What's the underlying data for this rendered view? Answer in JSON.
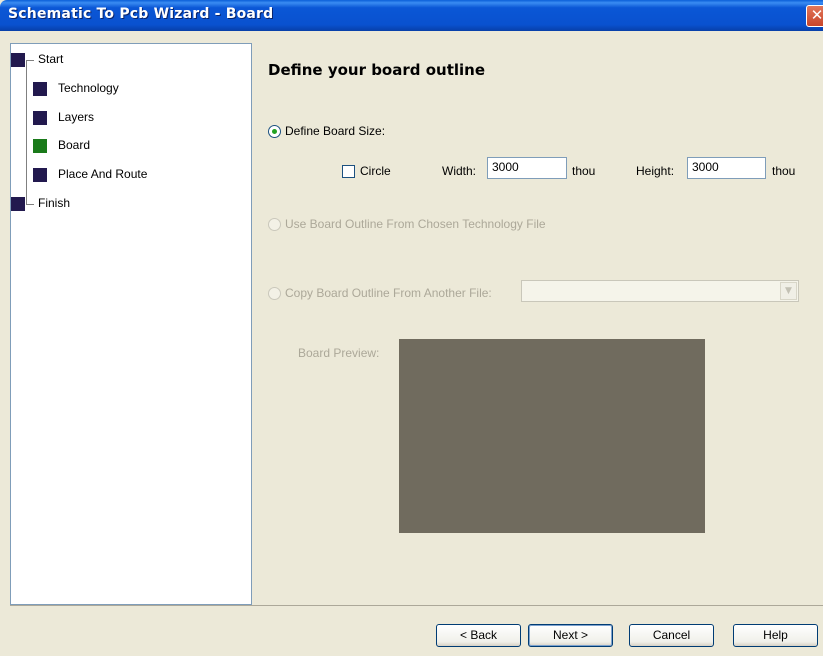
{
  "window": {
    "title": "Schematic To Pcb Wizard - Board",
    "close_glyph": "✕"
  },
  "sidebar": {
    "items": [
      {
        "label": "Start",
        "active": false
      },
      {
        "label": "Technology",
        "active": false
      },
      {
        "label": "Layers",
        "active": false
      },
      {
        "label": "Board",
        "active": true
      },
      {
        "label": "Place And Route",
        "active": false
      },
      {
        "label": "Finish",
        "active": false
      }
    ]
  },
  "main": {
    "heading": "Define your board outline",
    "define_size": {
      "label": "Define Board Size:",
      "selected": true,
      "circle_label": "Circle",
      "circle_checked": false,
      "width_label": "Width:",
      "width_value": "3000",
      "width_unit": "thou",
      "height_label": "Height:",
      "height_value": "3000",
      "height_unit": "thou"
    },
    "use_technology": {
      "label": "Use Board Outline From Chosen Technology File",
      "enabled": false
    },
    "copy_from_file": {
      "label": "Copy Board Outline From Another File:",
      "enabled": false,
      "value": ""
    },
    "preview": {
      "label": "Board Preview:",
      "color": "#706b5e"
    }
  },
  "buttons": {
    "back": "< Back",
    "next": "Next >",
    "cancel": "Cancel",
    "help": "Help"
  },
  "colors": {
    "titlebar": "#0b57d6",
    "active_step": "#1a7a1a",
    "inactive_step": "#22194e"
  }
}
